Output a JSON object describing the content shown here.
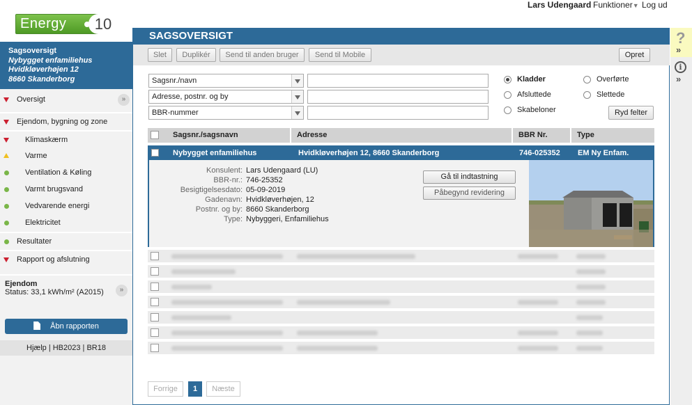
{
  "app": {
    "logo_left": "Energy",
    "logo_right": "10"
  },
  "header": {
    "user": "Lars Udengaard",
    "functions": "Funktioner",
    "logout": "Log ud"
  },
  "case_box": {
    "title": "Sagsoversigt",
    "name": "Nybygget enfamiliehus",
    "street": "Hvidkløverhøjen 12",
    "city": "8660 Skanderborg"
  },
  "sidebar": {
    "items": [
      {
        "label": "Oversigt",
        "marker": "red-triangle"
      },
      {
        "label": "Ejendom, bygning og zone",
        "marker": "red-triangle"
      },
      {
        "label": "Klimaskærm",
        "marker": "red-triangle"
      },
      {
        "label": "Varme",
        "marker": "yellow-triangle"
      },
      {
        "label": "Ventilation & Køling",
        "marker": "green-dot"
      },
      {
        "label": "Varmt brugsvand",
        "marker": "green-dot"
      },
      {
        "label": "Vedvarende energi",
        "marker": "green-dot"
      },
      {
        "label": "Elektricitet",
        "marker": "green-dot"
      },
      {
        "label": "Resultater",
        "marker": "green-dot"
      },
      {
        "label": "Rapport og afslutning",
        "marker": "red-triangle"
      }
    ],
    "ejendom_title": "Ejendom",
    "ejendom_status": "Status: 33,1 kWh/m² (A2015)",
    "open_report": "Åbn rapporten",
    "help_links": "Hjælp | HB2023 | BR18"
  },
  "main": {
    "title": "SAGSOVERSIGT",
    "toolbar": {
      "delete": "Slet",
      "duplicate": "Duplikér",
      "send_user": "Send til anden bruger",
      "send_mobile": "Send til Mobile",
      "create": "Opret"
    },
    "filters": {
      "select1": "Sagsnr./navn",
      "select2": "Adresse, postnr. og by",
      "select3": "BBR-nummer",
      "radios": {
        "kladder": "Kladder",
        "afsluttede": "Afsluttede",
        "skabeloner": "Skabeloner",
        "overforte": "Overførte",
        "slettede": "Slettede"
      },
      "clear": "Ryd felter"
    },
    "table": {
      "headers": {
        "name": "Sagsnr./sagsnavn",
        "address": "Adresse",
        "bbr": "BBR Nr.",
        "type": "Type"
      },
      "selected": {
        "name": "Nybygget enfamiliehus",
        "address": "Hvidkløverhøjen 12, 8660 Skanderborg",
        "bbr": "746-025352",
        "type": "EM Ny Enfam."
      },
      "details": {
        "labels": [
          "Konsulent:",
          "BBR-nr.:",
          "Besigtigelsesdato:",
          "Gadenavn:",
          "Postnr. og by:",
          "Type:"
        ],
        "values": [
          "Lars Udengaard (LU)",
          "746-25352",
          "05-09-2019",
          "Hvidkløverhøjen, 12",
          "8660 Skanderborg",
          "Nybyggeri, Enfamiliehus"
        ],
        "btn_go": "Gå til indtastning",
        "btn_revision": "Påbegynd revidering"
      }
    },
    "pager": {
      "prev": "Forrige",
      "page": "1",
      "next": "Næste"
    }
  },
  "rail": {
    "help": "?",
    "info": "i"
  },
  "colors": {
    "primary": "#2d6a98",
    "green": "#7ab648",
    "red": "#cc2030",
    "yellow": "#f0c020",
    "help_bg": "#fafac0"
  }
}
